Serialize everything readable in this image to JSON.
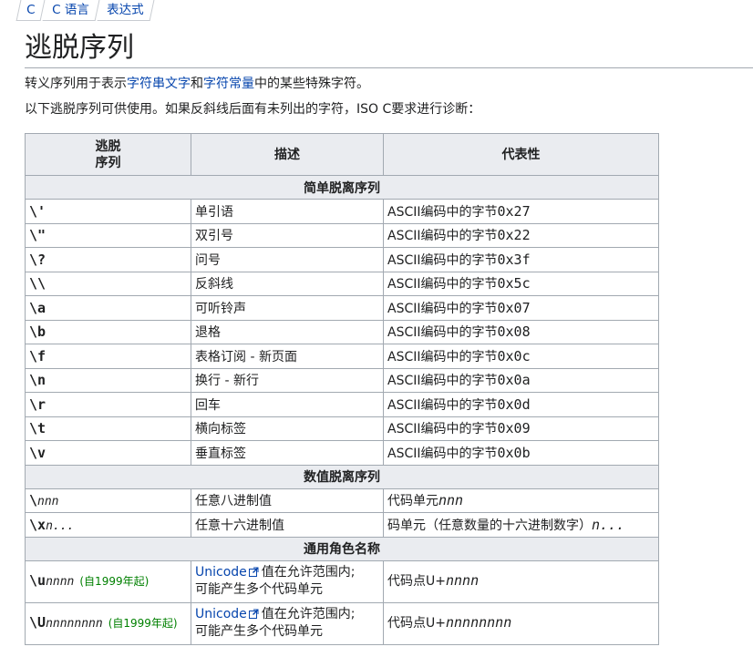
{
  "breadcrumb": [
    "C",
    "C 语言",
    "表达式"
  ],
  "title": "逃脱序列",
  "intro1": {
    "before": "转义序列用于表示",
    "link1": "字符串文字",
    "mid": "和",
    "link2": "字符常量",
    "after": "中的某些特殊字符。"
  },
  "intro2": "以下逃脱序列可供使用。如果反斜线后面有未列出的字符，ISO C要求进行诊断：",
  "table": {
    "headers": [
      "逃脱\n序列",
      "描述",
      "代表性"
    ],
    "sections": {
      "simple": "简单脱离序列",
      "numeric": "数值脱离序列",
      "universal": "通用角色名称"
    },
    "simple_rows": [
      {
        "seq": "\\'",
        "desc": "单引语",
        "rep_text": "ASCII编码中的字节",
        "rep_code": "0x27"
      },
      {
        "seq": "\\\"",
        "desc": "双引号",
        "rep_text": "ASCII编码中的字节",
        "rep_code": "0x22"
      },
      {
        "seq": "\\?",
        "desc": "问号",
        "rep_text": "ASCII编码中的字节",
        "rep_code": "0x3f"
      },
      {
        "seq": "\\\\",
        "desc": "反斜线",
        "rep_text": "ASCII编码中的字节",
        "rep_code": "0x5c"
      },
      {
        "seq": "\\a",
        "desc": "可听铃声",
        "rep_text": "ASCII编码中的字节",
        "rep_code": "0x07"
      },
      {
        "seq": "\\b",
        "desc": "退格",
        "rep_text": "ASCII编码中的字节",
        "rep_code": "0x08"
      },
      {
        "seq": "\\f",
        "desc": "表格订阅 - 新页面",
        "rep_text": "ASCII编码中的字节",
        "rep_code": "0x0c"
      },
      {
        "seq": "\\n",
        "desc": "换行 - 新行",
        "rep_text": "ASCII编码中的字节",
        "rep_code": "0x0a"
      },
      {
        "seq": "\\r",
        "desc": "回车",
        "rep_text": "ASCII编码中的字节",
        "rep_code": "0x0d"
      },
      {
        "seq": "\\t",
        "desc": "横向标签",
        "rep_text": "ASCII编码中的字节",
        "rep_code": "0x09"
      },
      {
        "seq": "\\v",
        "desc": "垂直标签",
        "rep_text": "ASCII编码中的字节",
        "rep_code": "0x0b"
      }
    ],
    "numeric_rows": [
      {
        "seq": "\\",
        "seq_var": "nnn",
        "desc": "任意八进制值",
        "rep_text": "代码单元",
        "rep_var": "nnn"
      },
      {
        "seq": "\\x",
        "seq_var": "n...",
        "desc": "任意十六进制值",
        "rep_text": "码单元（任意数量的十六进制数字）",
        "rep_var": "n..."
      }
    ],
    "universal_rows": [
      {
        "seq": "\\u",
        "seq_var": "nnnn",
        "since": "(自1999年起)",
        "link": "Unicode",
        "desc_after": "值在允许范围内;",
        "desc_line2": "可能产生多个代码单元",
        "rep_text": "代码点U+",
        "rep_var": "nnnn"
      },
      {
        "seq": "\\U",
        "seq_var": "nnnnnnnn",
        "since": "(自1999年起)",
        "link": "Unicode",
        "desc_after": "值在允许范围内;",
        "desc_line2": "可能产生多个代码单元",
        "rep_text": "代码点U+",
        "rep_var": "nnnnnnnn"
      }
    ]
  }
}
